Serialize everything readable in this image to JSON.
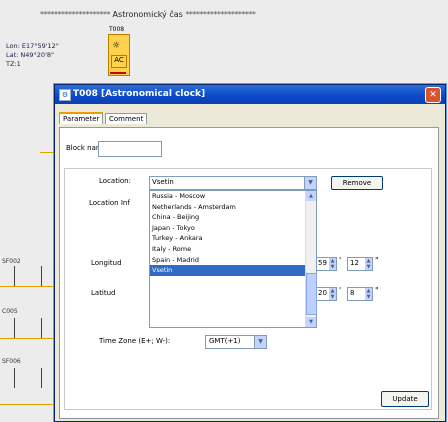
{
  "background": {
    "title": "Astronomický čas",
    "stars_left": "********************",
    "stars_right": "********************",
    "lon": "Lon: E17°59'12\"",
    "lat": "Lat: N49°20'8\"",
    "tz": "TZ:1",
    "block_label": "T008",
    "block_ac": "AC",
    "labels": [
      "SF002",
      "C005",
      "SF006"
    ]
  },
  "dialog": {
    "title": "T008 [Astronomical clock]",
    "close_glyph": "✕",
    "tabs": [
      "Parameter",
      "Comment"
    ],
    "block_name_label": "Block name",
    "block_name_value": "",
    "location_label": "Location:",
    "location_value": "Vsetin",
    "remove_button": "Remove",
    "location_info_label": "Location Inf",
    "longitude_label": "Longitud",
    "latitude_label": "Latitud",
    "location_list": [
      "Russia - Moscow",
      "Netherlands - Amsterdam",
      "China - Beijing",
      "Japan - Tokyo",
      "Turkey - Ankara",
      "Italy - Rome",
      "Spain - Madrid",
      "Vsetin"
    ],
    "selected_location": "Vsetin",
    "longitude_deg": "59",
    "longitude_min": "12",
    "latitude_deg": "20",
    "latitude_min": "8",
    "minute_unit": "'",
    "second_unit": "\"",
    "timezone_label": "Time Zone (E+; W-):",
    "timezone_value": "GMT(+1)",
    "update_button": "Update"
  }
}
